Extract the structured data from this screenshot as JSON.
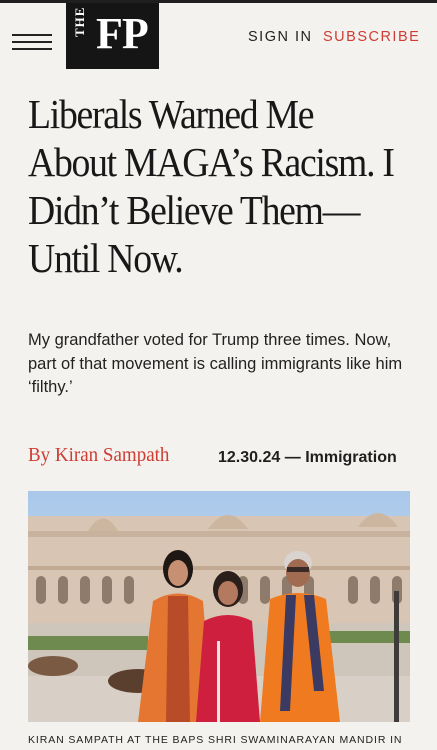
{
  "header": {
    "logo_prefix": "THE",
    "logo_main": "FP",
    "signin_label": "SIGN IN",
    "subscribe_label": "SUBSCRIBE"
  },
  "article": {
    "headline": "Liberals Warned Me About MAGA’s Racism. I Didn’t Believe Them—Until Now.",
    "dek": "My grandfather voted for Trump three times. Now, part of that movement is calling immigrants like him ‘filthy.’",
    "byline_prefix": "By",
    "author": "Kiran Sampath",
    "date": "12.30.24",
    "separator": "—",
    "topic": "Immigration",
    "photo_caption": "KIRAN SAMPATH AT THE BAPS SHRI SWAMINARAYAN MANDIR IN"
  },
  "colors": {
    "accent_red": "#cf3c34",
    "background": "#f3f2ee",
    "logo_bg": "#151515"
  },
  "icons": {
    "menu": "hamburger-menu-icon"
  }
}
